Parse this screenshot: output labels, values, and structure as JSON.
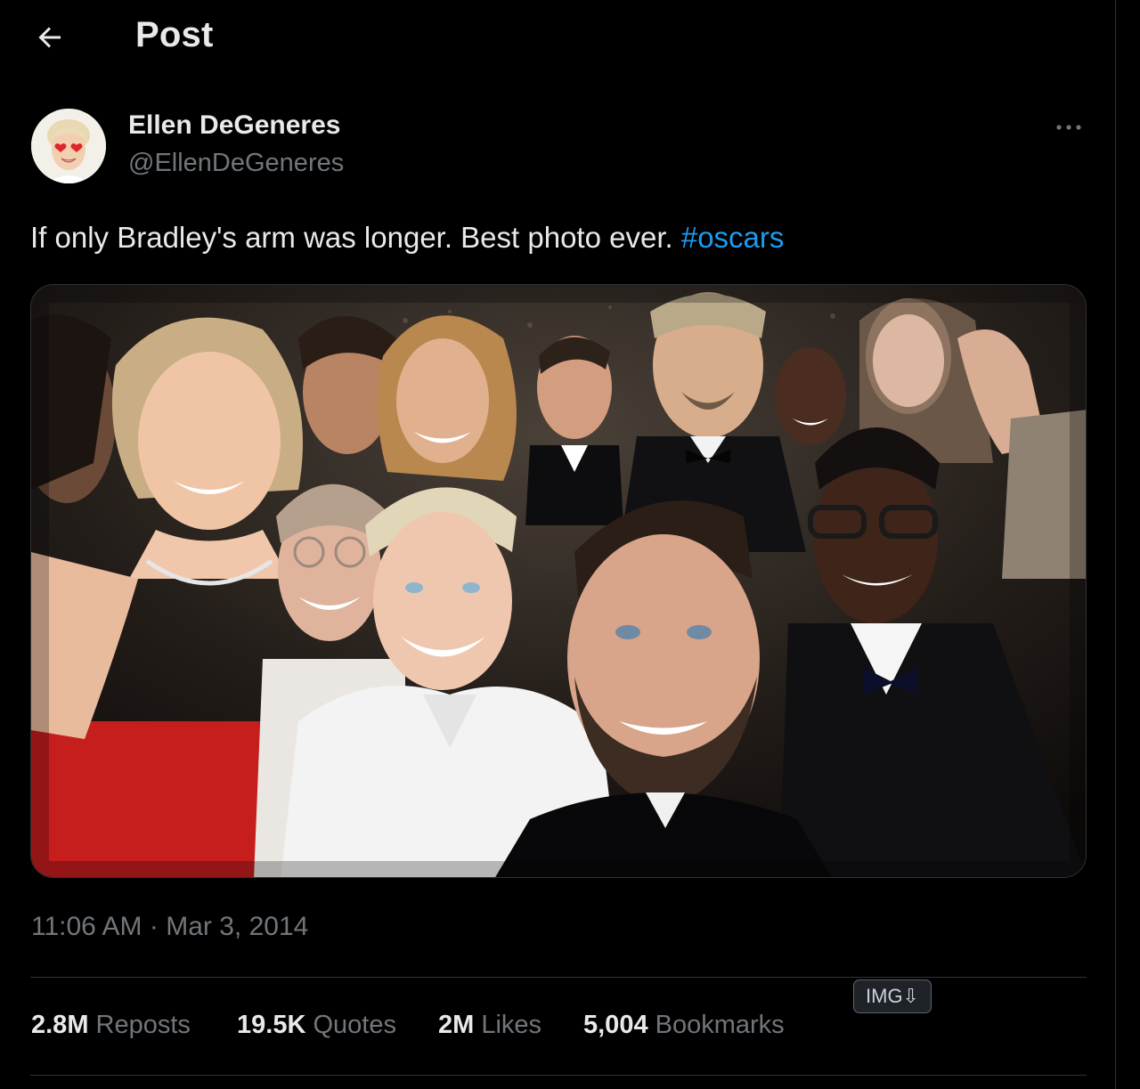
{
  "header": {
    "back_icon": "arrow-left-icon",
    "title": "Post"
  },
  "author": {
    "avatar_icon": "heart-eyes-avatar",
    "name": "Ellen DeGeneres",
    "handle": "@EllenDeGeneres",
    "more_icon": "more-horizontal-icon"
  },
  "tweet": {
    "text": "If only Bradley's arm was longer. Best photo ever.",
    "hashtag": "#oscars",
    "time": "11:06 AM",
    "separator": "·",
    "date": "Mar 3, 2014",
    "media_alt": "Group selfie photo"
  },
  "stats": [
    {
      "value": "2.8M",
      "label": "Reposts"
    },
    {
      "value": "19.5K",
      "label": "Quotes"
    },
    {
      "value": "2M",
      "label": "Likes"
    },
    {
      "value": "5,004",
      "label": "Bookmarks"
    }
  ],
  "badge": {
    "label": "IMG⇩"
  },
  "colors": {
    "background": "#000000",
    "text_primary": "#e7e9ea",
    "text_secondary": "#71767b",
    "link": "#1d9bf0",
    "border": "#2f3336"
  }
}
